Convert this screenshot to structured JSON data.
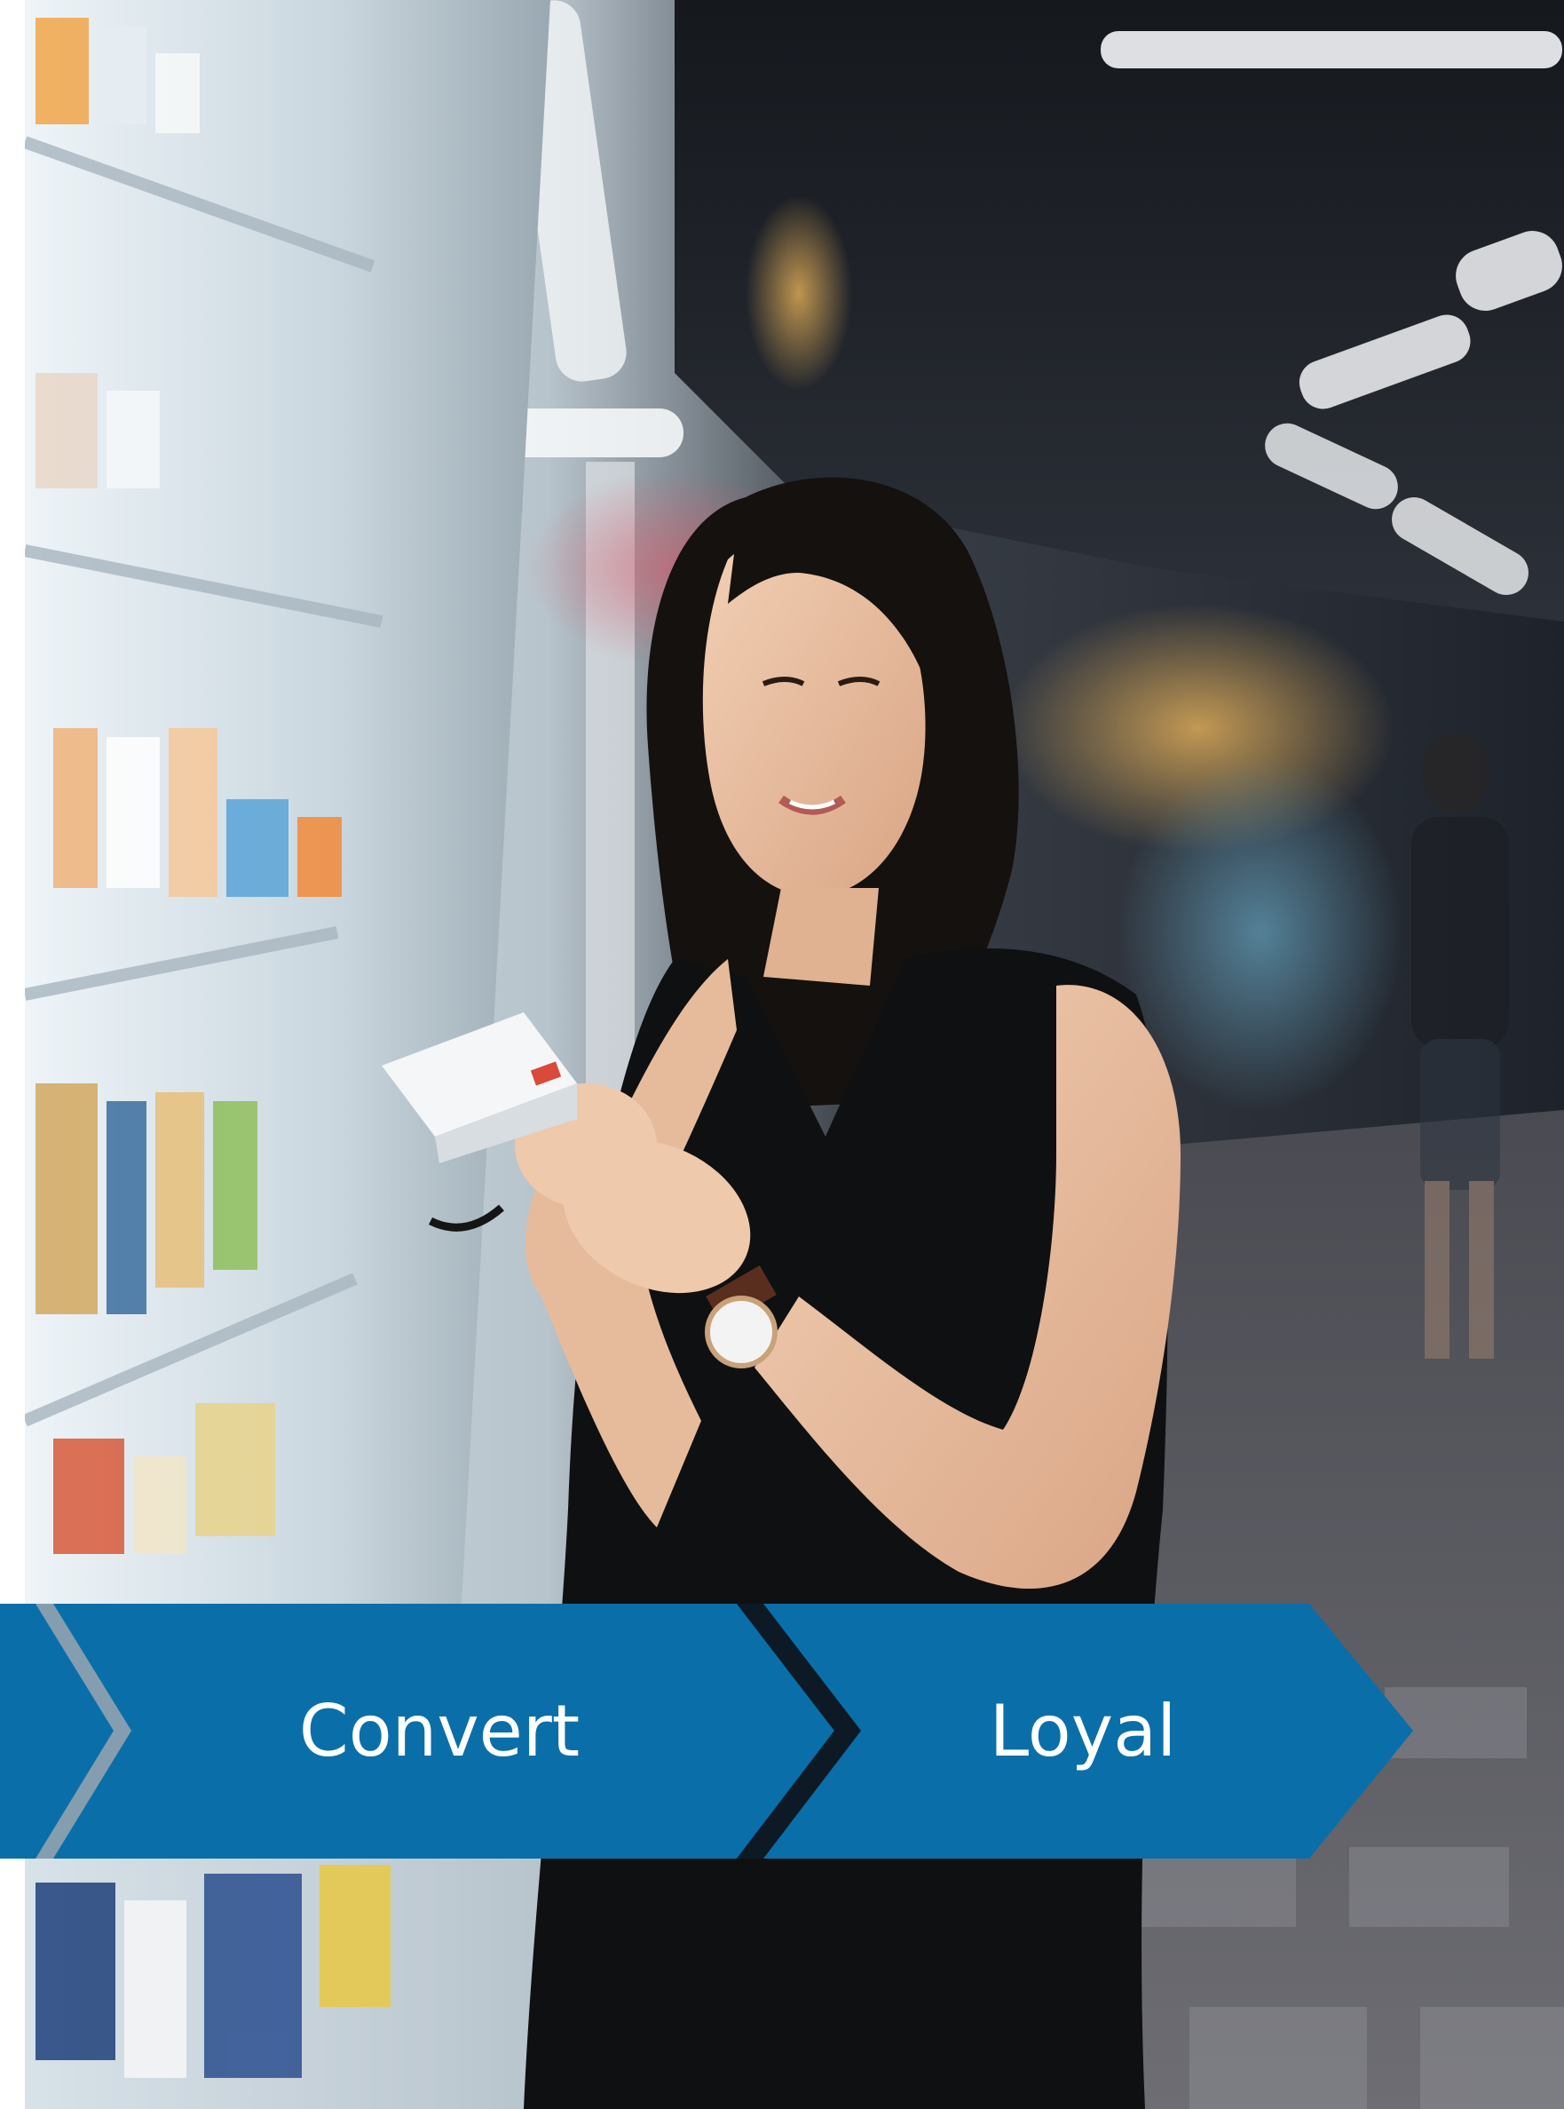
{
  "photo": {
    "subject": "woman-reading-product-package",
    "scene": "supermarket-aisle"
  },
  "funnel": {
    "steps": [
      {
        "label": "Convert"
      },
      {
        "label": "Loyal"
      }
    ],
    "colors": {
      "arrow_fill": "#0a6fa8",
      "arrow_separator": "#0d1a26",
      "label_text": "#ffffff"
    }
  }
}
